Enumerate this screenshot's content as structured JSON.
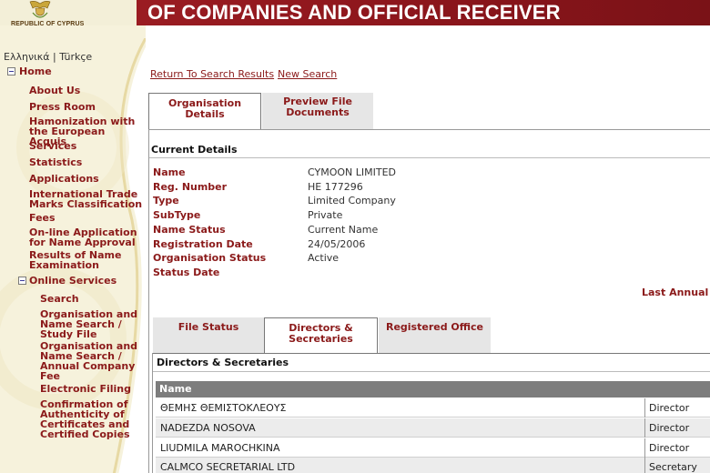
{
  "header": {
    "title": "OF COMPANIES AND OFFICIAL RECEIVER",
    "crest_caption": "REPUBLIC OF CYPRUS",
    "crest_icon": "coat-of-arms-icon"
  },
  "sidebar": {
    "languages": [
      "Ελληνικά",
      "Türkçe"
    ],
    "language_separator": "|",
    "home": "Home",
    "items": [
      "About Us",
      "Press Room",
      "Hamonization with the European Acquis",
      "Services",
      "Statistics",
      "Applications",
      "International Trade Marks Classification",
      "Fees",
      "On-line Application for Name Approval",
      "Results of Name Examination"
    ],
    "online_services": "Online Services",
    "sub_items": [
      "Search",
      "Organisation and Name Search / Study File",
      "Organisation and Name Search / Annual Company Fee",
      "Electronic Filing",
      "Confirmation of Authenticity of Certificates and Certified Copies"
    ]
  },
  "links": {
    "return": "Return To Search Results",
    "new_search": "New Search"
  },
  "tabs": {
    "organisation": "Organisation Details",
    "preview": "Preview File Documents"
  },
  "current": {
    "heading": "Current Details",
    "fields": [
      {
        "label": "Name",
        "value": "CYMOON LIMITED"
      },
      {
        "label": "Reg. Number",
        "value": "HE 177296"
      },
      {
        "label": "Type",
        "value": "Limited Company"
      },
      {
        "label": "SubType",
        "value": "Private"
      },
      {
        "label": "Name Status",
        "value": "Current Name"
      },
      {
        "label": "Registration Date",
        "value": "24/05/2006"
      },
      {
        "label": "Organisation Status",
        "value": "Active"
      },
      {
        "label": "Status Date",
        "value": ""
      }
    ],
    "last_annual": "Last Annual R"
  },
  "subtabs": {
    "file_status": "File Status",
    "directors": "Directors & Secretaries",
    "registered_office": "Registered Office"
  },
  "directors": {
    "heading": "Directors & Secretaries",
    "col_name": "Name",
    "rows": [
      {
        "name": "ΘΕΜΗΣ ΘΕΜΙΣΤΟΚΛΕΟΥΣ",
        "role": "Director"
      },
      {
        "name": "NADEZDA NOSOVA",
        "role": "Director"
      },
      {
        "name": "LIUDMILA MAROCHKINA",
        "role": "Director"
      },
      {
        "name": "CALMCO SECRETARIAL LTD",
        "role": "Secretary"
      }
    ]
  },
  "colors": {
    "brand_red": "#8b1a1a",
    "header_red": "#8c1a1f",
    "sidebar_bg": "#f6f2dc"
  }
}
